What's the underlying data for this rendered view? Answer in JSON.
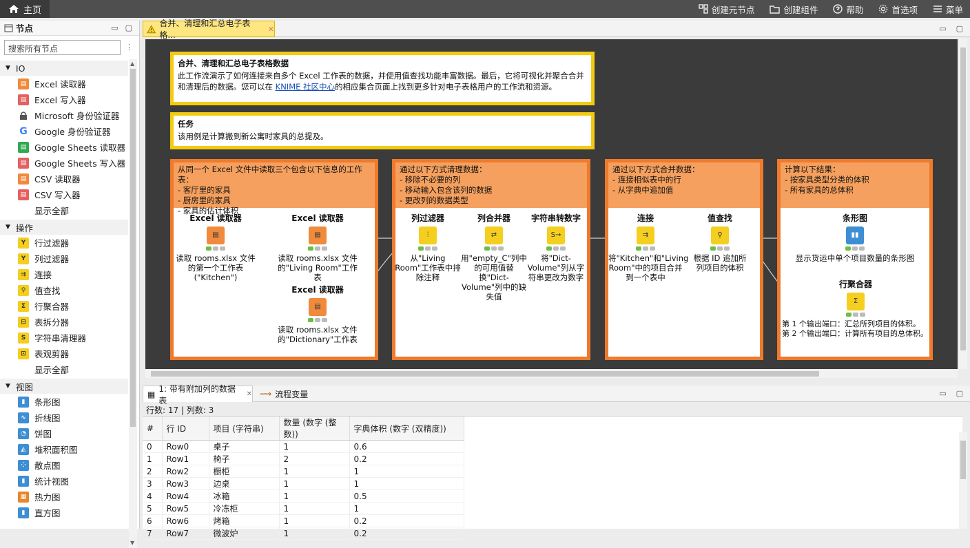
{
  "topbar": {
    "home": "主页",
    "actions": [
      {
        "label": "创建元节点",
        "icon": "metanode-icon"
      },
      {
        "label": "创建组件",
        "icon": "folder-icon"
      },
      {
        "label": "帮助",
        "icon": "help-icon"
      },
      {
        "label": "首选项",
        "icon": "gear-icon"
      },
      {
        "label": "菜单",
        "icon": "menu-icon"
      }
    ]
  },
  "left": {
    "title": "节点",
    "search_placeholder": "搜索所有节点",
    "categories": [
      {
        "name": "IO",
        "items": [
          {
            "label": "Excel 读取器",
            "icon": "orange"
          },
          {
            "label": "Excel 写入器",
            "icon": "red"
          },
          {
            "label": "Microsoft 身份验证器",
            "icon": "lock"
          },
          {
            "label": "Google 身份验证器",
            "icon": "google"
          },
          {
            "label": "Google Sheets 读取器",
            "icon": "green"
          },
          {
            "label": "Google Sheets 写入器",
            "icon": "red"
          },
          {
            "label": "CSV 读取器",
            "icon": "orange"
          },
          {
            "label": "CSV 写入器",
            "icon": "red"
          },
          {
            "label": "显示全部",
            "icon": ""
          }
        ]
      },
      {
        "name": "操作",
        "items": [
          {
            "label": "行过滤器",
            "icon": "yellow"
          },
          {
            "label": "列过滤器",
            "icon": "yellow"
          },
          {
            "label": "连接",
            "icon": "yellow"
          },
          {
            "label": "值查找",
            "icon": "yellow"
          },
          {
            "label": "行聚合器",
            "icon": "yellow"
          },
          {
            "label": "表拆分器",
            "icon": "yellow"
          },
          {
            "label": "字符串清理器",
            "icon": "yellow"
          },
          {
            "label": "表观剪器",
            "icon": "yellow"
          },
          {
            "label": "显示全部",
            "icon": ""
          }
        ]
      },
      {
        "name": "视图",
        "items": [
          {
            "label": "条形图",
            "icon": "blue"
          },
          {
            "label": "折线图",
            "icon": "blue"
          },
          {
            "label": "饼图",
            "icon": "blue"
          },
          {
            "label": "堆积面积图",
            "icon": "blue"
          },
          {
            "label": "散点图",
            "icon": "blue"
          },
          {
            "label": "统计视图",
            "icon": "blue"
          },
          {
            "label": "热力图",
            "icon": "blue"
          },
          {
            "label": "直方图",
            "icon": "blue"
          }
        ]
      }
    ]
  },
  "editor": {
    "tab": "合并、清理和汇总电子表格..."
  },
  "annotations": {
    "intro_title": "合并、清理和汇总电子表格数据",
    "intro_text_1": "此工作流演示了如何连接来自多个 Excel 工作表的数据，并使用值查找功能丰富数据。最后，它将可视化并聚合合并和清理后的数据。您可以在 ",
    "intro_link": "KNIME 社区中心",
    "intro_text_2": "的相应集合页面上找到更多针对电子表格用户的工作流和资源。",
    "task_title": "任务",
    "task_text": "该用例是计算搬到新公寓时家具的总提及。",
    "g1_head": [
      "从同一个 Excel 文件中读取三个包含以下信息的工作表：",
      "- 客厅里的家具",
      "- 厨房里的家具",
      "- 家具的估计体积"
    ],
    "g2_head": [
      "通过以下方式清理数据：",
      "- 移除不必要的列",
      "- 移动输入包含该列的数据",
      "- 更改列的数据类型"
    ],
    "g3_head": [
      "通过以下方式合并数据：",
      "- 连接相似表中的行",
      "- 从字典中追加值"
    ],
    "g4_head": [
      "计算以下结果：",
      "- 按家具类型分类的体积",
      "- 所有家具的总体积"
    ]
  },
  "nodes": [
    {
      "title": "Excel 读取器",
      "desc": "读取 rooms.xlsx 文件的第一个工作表 (\"Kitchen\")",
      "color": "orange"
    },
    {
      "title": "Excel 读取器",
      "desc": "读取 rooms.xlsx 文件的\"Living Room\"工作表",
      "color": "orange"
    },
    {
      "title": "Excel 读取器",
      "desc": "读取 rooms.xlsx 文件的\"Dictionary\"工作表",
      "color": "orange"
    },
    {
      "title": "列过滤器",
      "desc": "从\"Living Room\"工作表中排除注释",
      "color": "yellow"
    },
    {
      "title": "列合并器",
      "desc": "用\"empty_C\"列中的可用值替换\"Dict-Volume\"列中的缺失值",
      "color": "yellow"
    },
    {
      "title": "字符串转数字",
      "desc": "将\"Dict-Volume\"列从字符串更改为数字",
      "color": "yellow"
    },
    {
      "title": "连接",
      "desc": "将\"Kitchen\"和\"Living Room\"中的项目合并到一个表中",
      "color": "yellow"
    },
    {
      "title": "值查找",
      "desc": "根据 ID 追加所列项目的体积",
      "color": "yellow"
    },
    {
      "title": "条形图",
      "desc": "显示货运中单个项目数量的条形图",
      "color": "blue"
    },
    {
      "title": "行聚合器",
      "desc": "第 1 个输出端口：汇总所列项目的体积。\n第 2 个输出端口：计算所有项目的总体积。",
      "color": "yellow"
    }
  ],
  "bottom": {
    "tab1": "1: 带有附加列的数据表",
    "tab2": "流程变量",
    "info": "行数: 17 | 列数: 3",
    "columns": [
      "#",
      "行 ID",
      "项目 (字符串)",
      "数量 (数字 (整数))",
      "字典体积 (数字 (双精度))"
    ],
    "rows": [
      [
        "0",
        "Row0",
        "桌子",
        "1",
        "0.6"
      ],
      [
        "1",
        "Row1",
        "椅子",
        "2",
        "0.2"
      ],
      [
        "2",
        "Row2",
        "橱柜",
        "1",
        "1"
      ],
      [
        "3",
        "Row3",
        "边桌",
        "1",
        "1"
      ],
      [
        "4",
        "Row4",
        "冰箱",
        "1",
        "0.5"
      ],
      [
        "5",
        "Row5",
        "冷冻柜",
        "1",
        "1"
      ],
      [
        "6",
        "Row6",
        "烤箱",
        "1",
        "0.2"
      ],
      [
        "7",
        "Row7",
        "微波炉",
        "1",
        "0.2"
      ]
    ]
  }
}
